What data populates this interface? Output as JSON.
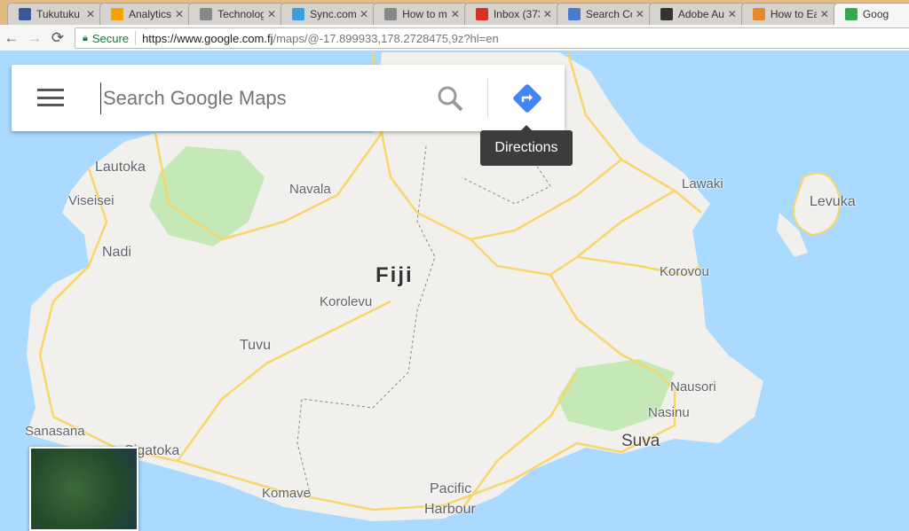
{
  "browser": {
    "tabs": [
      {
        "label": "Tukutuku l",
        "icon": "facebook-icon",
        "color": "#3b5998"
      },
      {
        "label": "Analytics",
        "icon": "analytics-icon",
        "color": "#f4a300"
      },
      {
        "label": "Technolog",
        "icon": "page-icon",
        "color": "#888"
      },
      {
        "label": "Sync.com",
        "icon": "sync-icon",
        "color": "#39a0e0"
      },
      {
        "label": "How to m",
        "icon": "page-icon",
        "color": "#888"
      },
      {
        "label": "Inbox (373",
        "icon": "gmail-icon",
        "color": "#d93025"
      },
      {
        "label": "Search Co",
        "icon": "search-console-icon",
        "color": "#4a7bd0"
      },
      {
        "label": "Adobe Au",
        "icon": "apple-icon",
        "color": "#333"
      },
      {
        "label": "How to Ea",
        "icon": "site-icon",
        "color": "#e88a2a"
      },
      {
        "label": "Goog",
        "icon": "google-maps-icon",
        "color": "#34a853",
        "active": true
      }
    ],
    "secure_label": "Secure",
    "url_host": "https://www.google.com.fj",
    "url_path": "/maps/@-17.899933,178.2728475,9z?hl=en"
  },
  "search": {
    "placeholder": "Search Google Maps",
    "tooltip": "Directions"
  },
  "map": {
    "labels": [
      "Lautoka",
      "Viseisei",
      "Nadi",
      "Navala",
      "Fiji",
      "Korolevu",
      "Tuvu",
      "Sanasana",
      "Sigatoka",
      "Komave",
      "Pacific",
      "Harbour",
      "Lawaki",
      "Levuka",
      "Korovou",
      "Nausori",
      "Nasinu",
      "Suva"
    ],
    "colors": {
      "water": "#aadaff",
      "land": "#f1f0ed",
      "park": "#c5e8b7",
      "road": "#f9d56a"
    }
  }
}
